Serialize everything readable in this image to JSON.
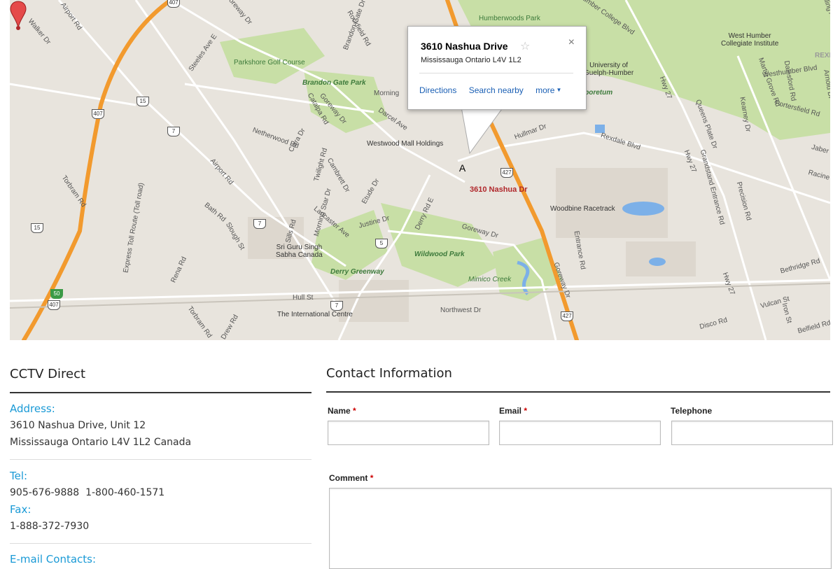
{
  "map": {
    "labels": {
      "humberwoods_park": "Humberwoods Park",
      "west_humber_ci": "West Humber\nCollegiate Institute",
      "university_guelph_humber": "University of\nGuelph-Humber",
      "arboretum": "Arboretum",
      "parkshore_golf": "Parkshore Golf Course",
      "brandon_gate_park": "Brandon Gate Park",
      "westwood_mall": "Westwood Mall Holdings",
      "woodbine_racetrack": "Woodbine Racetrack",
      "sri_guru": "Sri Guru Singh\nSabha Canada",
      "wildwood_park": "Wildwood Park",
      "derry_greenway": "Derry Greenway",
      "mimico_creek": "Mimico Creek",
      "international_centre": "The International Centre",
      "airport_rd": "Airport Rd",
      "airport_rd2": "Airport Rd",
      "walker_dr": "Walker Dr",
      "steeles_ave": "Steeles Ave E",
      "goreway_dr": "Goreway Dr",
      "goreway_dr2": "Goreway Dr",
      "goreway_dr3": "Goreway Dr",
      "goreway_dr4": "Goreway Dr",
      "brandon_gate": "Brandon Gate Dr",
      "rockfield_rd": "Rockfield Rd",
      "humber_college_blvd": "Humber College Blvd",
      "westhumber_blvd": "Westhumber Blvd",
      "kipling_ave": "Kipling Ave",
      "hwy27": "Hwy 27",
      "hwy27b": "Hwy 27",
      "hwy27c": "Hwy 27",
      "rexdale_blvd": "Rexdale Blvd",
      "morning": "Morning",
      "darcel_ave": "Darcel Ave",
      "hullmar_dr": "Hullmar Dr",
      "netherwood_rd": "Netherwood Rd",
      "clara_dr": "Clara Dr",
      "catalpa_rd": "Catalpa Rd",
      "twilight_rd": "Twilight Rd",
      "express_toll": "Express Toll Route (Toll road)",
      "torbram_rd": "Torbram Rd",
      "torbram_rd2": "Torbram Rd",
      "bath_rd": "Bath Rd",
      "slough_st": "Slough St",
      "rena_rd": "Rena Rd",
      "drew_rd": "Drew Rd",
      "morning_star_dr": "Morning Star Dr",
      "cambrett_dr": "Cambrett Dr",
      "etude_dr": "Etude Dr",
      "derry_rd_e": "Derry Rd E",
      "justine_dr": "Justine Dr",
      "lancaster_ave": "Lancaster Ave",
      "sills_rd": "Sills Rd",
      "hull_st": "Hull St",
      "northwest_dr": "Northwest Dr",
      "queens_plate_dr": "Queens Plate Dr",
      "grandstand_rd": "Grandstand Entrance Rd",
      "entrance_rd": "Entrance Rd",
      "precision_rd": "Precision Rd",
      "bethridge_rd": "Bethridge Rd",
      "disco_rd": "Disco Rd",
      "vulcan_st": "Vulcan St",
      "iron_st": "Iron St",
      "belfield_rd": "Belfield Rd",
      "martin_grove_rd": "Martin Grove Rd",
      "kearney_dr": "Kearney Dr",
      "dalesford_rd": "Dalesford Rd",
      "arnold_dr": "Arnold Dr",
      "portersfield_rd": "Portersfield Rd",
      "racine_rd": "Racine Rd",
      "jaber": "Jaber",
      "rexdale": "REXI"
    },
    "shields": [
      "407",
      "407",
      "407",
      "15",
      "15",
      "7",
      "7",
      "7",
      "5",
      "427",
      "427",
      "50"
    ],
    "popup": {
      "title": "3610 Nashua Drive",
      "address": "Mississauga Ontario L4V 1L2",
      "links": [
        "Directions",
        "Search nearby",
        "more"
      ],
      "close": "×",
      "star": "☆"
    },
    "marker": {
      "letter": "A",
      "label": "3610 Nashua Dr"
    }
  },
  "company": {
    "name": "CCTV Direct",
    "address_label": "Address:",
    "address_line1": "3610 Nashua Drive, Unit 12",
    "address_line2": "Mississauga Ontario L4V 1L2 Canada",
    "tel_label": "Tel:",
    "tel_value": "905-676-9888  1-800-460-1571",
    "fax_label": "Fax:",
    "fax_value": "1-888-372-7930",
    "email_label": "E-mail Contacts:"
  },
  "contact_form": {
    "title": "Contact Information",
    "name_label": "Name",
    "email_label": "Email",
    "telephone_label": "Telephone",
    "comment_label": "Comment",
    "required_mark": "*"
  },
  "colors": {
    "link_blue": "#1a9ad6",
    "highway_orange": "#f29a2e",
    "park_green": "#c8dfa6",
    "required_red": "#cc0000"
  }
}
